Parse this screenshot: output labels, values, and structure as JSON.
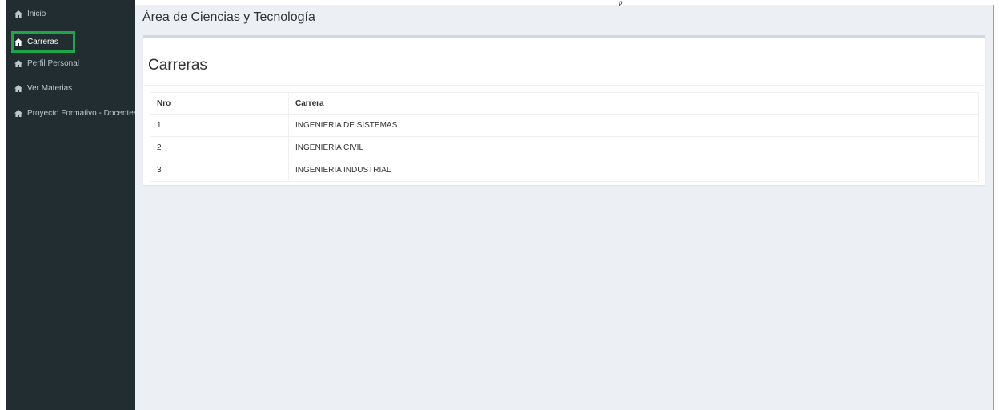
{
  "sidebar": {
    "items": [
      {
        "label": "Inicio",
        "icon": "home-icon",
        "active": false
      },
      {
        "label": "Carreras",
        "icon": "home-icon",
        "active": true
      },
      {
        "label": "Perfil Personal",
        "icon": "home-icon",
        "active": false
      },
      {
        "label": "Ver Materias",
        "icon": "home-icon",
        "active": false
      },
      {
        "label": "Proyecto Formativo - Docentes",
        "icon": "home-icon",
        "active": false
      }
    ],
    "highlight_color": "#1fa64a"
  },
  "header": {
    "title": "Área de Ciencias y Tecnología"
  },
  "main": {
    "box_title": "Carreras",
    "table": {
      "columns": [
        "Nro",
        "Carrera"
      ],
      "rows": [
        [
          "1",
          "INGENIERIA DE SISTEMAS"
        ],
        [
          "2",
          "INGENIERIA CIVIL"
        ],
        [
          "3",
          "INGENIERIA INDUSTRIAL"
        ]
      ]
    }
  },
  "colors": {
    "sidebar_bg": "#222d32",
    "content_bg": "#ecf0f5",
    "box_bg": "#ffffff"
  }
}
